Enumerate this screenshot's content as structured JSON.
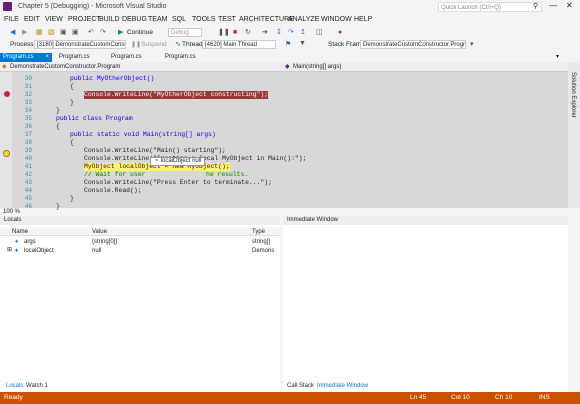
{
  "window": {
    "title": "Chapter 5 (Debugging) - Microsoft Visual Studio",
    "quick_launch": "Quick Launch (Ctrl+Q)"
  },
  "menu": [
    "FILE",
    "EDIT",
    "VIEW",
    "PROJECT",
    "BUILD",
    "DEBUG",
    "TEAM",
    "SQL",
    "TOOLS",
    "TEST",
    "ARCHITECTURE",
    "ANALYZE",
    "WINDOW",
    "HELP"
  ],
  "toolbar": {
    "continue_label": "Continue",
    "config_value": "Debug"
  },
  "debug_location": {
    "process_label": "Process:",
    "process_value": "[3180] DemonstrateCustomConstr",
    "suspend_label": "Suspend",
    "thread_label": "Thread:",
    "thread_value": "[4620] Main Thread",
    "stack_label": "Stack Frame:",
    "stack_value": "DemonstrateCustomConstructor.Program"
  },
  "tabs": [
    "Program.cs",
    "Program.cs",
    "Program.cs",
    "Program.cs"
  ],
  "nav": {
    "left": "DemonstrateCustomConstructor.Program",
    "right": "Main(string[] args)"
  },
  "side_panel": "Solution Explorer",
  "editor": {
    "lines": [
      "30",
      "31",
      "32",
      "33",
      "34",
      "35",
      "36",
      "37",
      "38",
      "39",
      "40",
      "41",
      "42",
      "43",
      "44",
      "45",
      "46"
    ],
    "code": {
      "l30": "public MyOtherObject()",
      "l31": "{",
      "l32": "Console.WriteLine(\"MyOtherObject constructing\");",
      "l33": "}",
      "l34": "}",
      "l35": "public class Program",
      "l36": "{",
      "l37": "public static void Main(string[] args)",
      "l38": "{",
      "l39": "Console.WriteLine(\"Main() starting\");",
      "l40": "Console.WriteLine(\"Creating a local MyObject in Main():\");",
      "l41": "MyObject localObject = new MyObject();",
      "l42a": "// Wait for user",
      "l42b": "he results.",
      "l43": "Console.WriteLine(\"Press Enter to terminate...\");",
      "l44": "Console.Read();",
      "l45": "}",
      "l46": "}"
    },
    "datatip": {
      "name": "localObject",
      "value": "null"
    },
    "zoom": "100 %"
  },
  "locals": {
    "title": "Locals",
    "headers": [
      "Name",
      "Value",
      "Type"
    ],
    "rows": [
      {
        "name": "args",
        "value": "{string[0]}",
        "type": "string[]"
      },
      {
        "name": "localObject",
        "value": "null",
        "type": "Demons"
      }
    ],
    "tabs": [
      "Locals",
      "Watch 1"
    ]
  },
  "immediate": {
    "title": "Immediate Window",
    "tabs": [
      "Call Stack",
      "Immediate Window"
    ]
  },
  "status": {
    "ready": "Ready",
    "ln": "Ln 45",
    "col": "Col 10",
    "ch": "Ch 10",
    "ins": "INS"
  },
  "colors": {
    "accent": "#007acc",
    "status_bar": "#ca5100",
    "breakpoint": "#c5283d",
    "current_line": "#fff36a"
  }
}
